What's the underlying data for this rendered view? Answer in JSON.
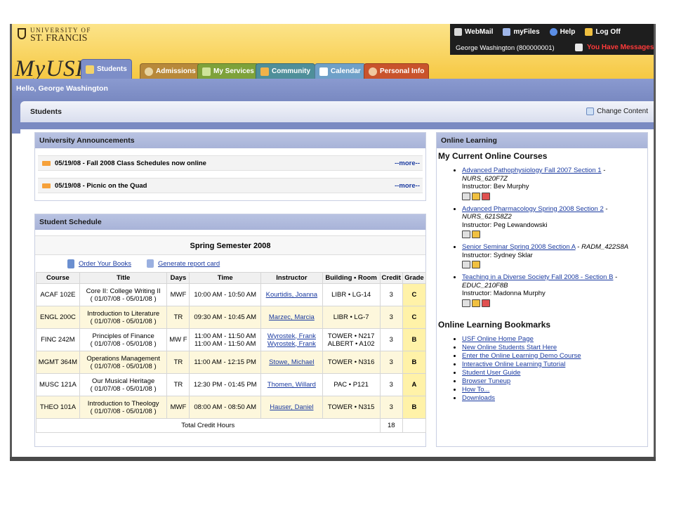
{
  "header": {
    "logo_line1": "UNIVERSITY OF",
    "logo_line2": "ST. FRANCIS",
    "brand": "MyUSF",
    "topnav": [
      "WebMail",
      "myFiles",
      "Help",
      "Log Off"
    ],
    "user": "George Washington (800000001)",
    "messages": "You Have Messages"
  },
  "tabs": [
    "Students",
    "Admissions",
    "My Services",
    "Community",
    "Calendar",
    "Personal Info"
  ],
  "hello": "Hello, George Washington",
  "subheader": {
    "title": "Students",
    "change_content": "Change Content"
  },
  "announcements": {
    "title": "University Announcements",
    "items": [
      {
        "text": "05/19/08 - Fall 2008 Class Schedules now online",
        "more": "--more--"
      },
      {
        "text": "05/19/08 - Picnic on the Quad",
        "more": "--more--"
      }
    ]
  },
  "schedule": {
    "title": "Student Schedule",
    "semester": "Spring Semester 2008",
    "order_books": "Order Your Books",
    "report_card": "Generate report card",
    "columns": [
      "Course",
      "Title",
      "Days",
      "Time",
      "Instructor",
      "Building • Room",
      "Credit",
      "Grade"
    ],
    "rows": [
      {
        "course": "ACAF 102E",
        "title1": "Core II: College Writing II",
        "title2": "( 01/07/08 - 05/01/08 )",
        "days": "MWF",
        "time1": "10:00 AM - 10:50 AM",
        "time2": "",
        "inst1": "Kourtidis, Joanna",
        "inst2": "",
        "room1": "LIBR • LG-14",
        "room2": "",
        "credit": "3",
        "grade": "C"
      },
      {
        "course": "ENGL 200C",
        "title1": "Introduction to Literature",
        "title2": "( 01/07/08 - 05/01/08 )",
        "days": "TR",
        "time1": "09:30 AM - 10:45 AM",
        "time2": "",
        "inst1": "Marzec, Marcia",
        "inst2": "",
        "room1": "LIBR • LG-7",
        "room2": "",
        "credit": "3",
        "grade": "C"
      },
      {
        "course": "FINC 242M",
        "title1": "Principles of Finance",
        "title2": "( 01/07/08 - 05/01/08 )",
        "days": "MW F",
        "time1": "11:00 AM - 11:50 AM",
        "time2": "11:00 AM - 11:50 AM",
        "inst1": "Wyrostek, Frank",
        "inst2": "Wyrostek, Frank",
        "room1": "TOWER • N217",
        "room2": "ALBERT • A102",
        "credit": "3",
        "grade": "B"
      },
      {
        "course": "MGMT 364M",
        "title1": "Operations Management",
        "title2": "( 01/07/08 - 05/01/08 )",
        "days": "TR",
        "time1": "11:00 AM - 12:15 PM",
        "time2": "",
        "inst1": "Stowe, Michael",
        "inst2": "",
        "room1": "TOWER • N316",
        "room2": "",
        "credit": "3",
        "grade": "B"
      },
      {
        "course": "MUSC 121A",
        "title1": "Our Musical Heritage",
        "title2": "( 01/07/08 - 05/01/08 )",
        "days": "TR",
        "time1": "12:30 PM - 01:45 PM",
        "time2": "",
        "inst1": "Thomen, Willard",
        "inst2": "",
        "room1": "PAC • P121",
        "room2": "",
        "credit": "3",
        "grade": "A"
      },
      {
        "course": "THEO 101A",
        "title1": "Introduction to Theology",
        "title2": "( 01/07/08 - 05/01/08 )",
        "days": "MWF",
        "time1": "08:00 AM - 08:50 AM",
        "time2": "",
        "inst1": "Hauser, Daniel",
        "inst2": "",
        "room1": "TOWER • N315",
        "room2": "",
        "credit": "3",
        "grade": "B"
      }
    ],
    "total_label": "Total Credit Hours",
    "total_value": "18"
  },
  "online": {
    "title": "Online Learning",
    "current_heading": "My Current Online Courses",
    "courses": [
      {
        "link": "Advanced Pathophysiology Fall 2007 Section 1",
        "sep": " -",
        "code": "NURS_620F7Z",
        "instructor": "Instructor: Bev Murphy",
        "icons": 3
      },
      {
        "link": "Advanced Pharmacology Spring 2008 Section 2",
        "sep": " -",
        "code": "NURS_621S8Z2",
        "instructor": "Instructor: Peg Lewandowski",
        "icons": 2
      },
      {
        "link": "Senior Seminar Spring 2008 Section A",
        "sep": " - ",
        "code": "RADM_422S8A",
        "instructor": "Instructor: Sydney Sklar",
        "icons": 2
      },
      {
        "link": "Teaching in a Diverse Society Fall 2008 - Section B",
        "sep": " -",
        "code": "EDUC_210F8B",
        "instructor": "Instructor: Madonna Murphy",
        "icons": 3
      }
    ],
    "bookmarks_heading": "Online Learning Bookmarks",
    "bookmarks": [
      "USF Online Home Page",
      "New Online Students Start Here",
      "Enter the Online Learning Demo Course",
      "Interactive Online Learning Tutorial",
      "Student User Guide",
      "Browser Tuneup",
      "How To...",
      "Downloads"
    ]
  },
  "colors": {
    "header_gold": "#f6c842",
    "nav_blue": "#7a8ac2",
    "link_blue": "#1a3aa0",
    "alert_red": "#ff3a3a"
  }
}
